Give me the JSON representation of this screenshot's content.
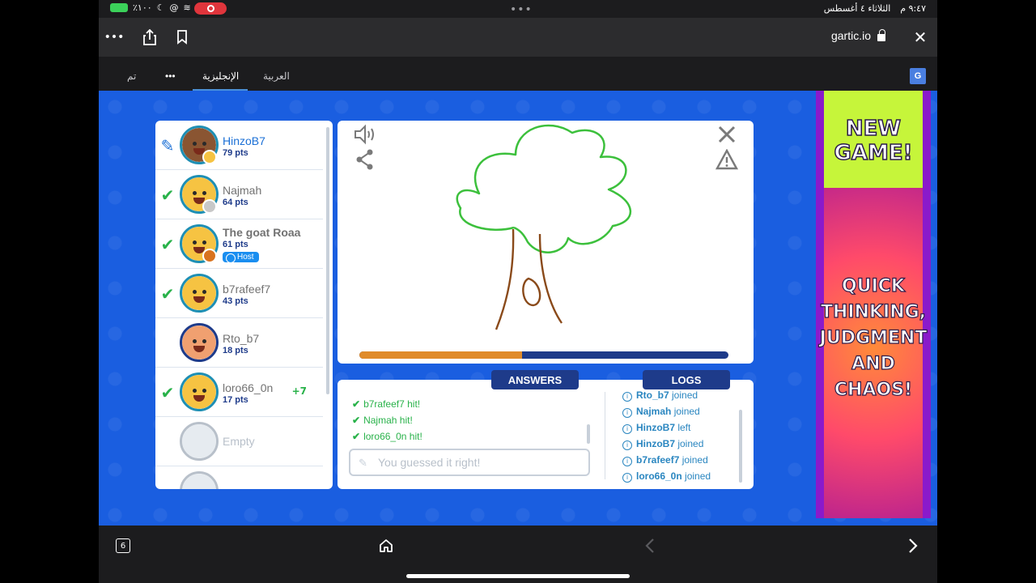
{
  "status": {
    "time": "٩:٤٧ م",
    "date": "الثلاثاء ٤ أغسطس",
    "battery": "٪١٠٠"
  },
  "browser": {
    "url": "gartic.io",
    "more_label": "•••",
    "close_label": "✕"
  },
  "translate": {
    "done_label": "تم",
    "more_label": "•••",
    "english_label": "الإنجليزية",
    "arabic_label": "العربية"
  },
  "players": [
    {
      "name": "HinzoB7",
      "pts": "79 pts",
      "status": "drawing",
      "gain": ""
    },
    {
      "name": "Najmah",
      "pts": "64 pts",
      "status": "guessed",
      "gain": ""
    },
    {
      "name": "The goat Roaa",
      "pts": "61 pts",
      "status": "guessed",
      "gain": "",
      "host_label": "Host"
    },
    {
      "name": "b7rafeef7",
      "pts": "43 pts",
      "status": "guessed",
      "gain": ""
    },
    {
      "name": "Rto_b7",
      "pts": "18 pts",
      "status": "none",
      "gain": ""
    },
    {
      "name": "loro66_0n",
      "pts": "17 pts",
      "status": "guessed",
      "gain": "+7"
    },
    {
      "name": "Empty",
      "pts": "",
      "status": "empty",
      "gain": ""
    }
  ],
  "round": {
    "progress_fraction": 0.44
  },
  "chat": {
    "answers_tab": "ANSWERS",
    "logs_tab": "LOGS",
    "answers": [
      {
        "name": "b7rafeef7",
        "text": "hit!"
      },
      {
        "name": "Najmah",
        "text": "hit!"
      },
      {
        "name": "loro66_0n",
        "text": "hit!"
      }
    ],
    "input_placeholder": "You guessed it right!",
    "logs": [
      {
        "name": "Rto_b7",
        "text": "joined"
      },
      {
        "name": "Najmah",
        "text": "joined"
      },
      {
        "name": "HinzoB7",
        "text": "left"
      },
      {
        "name": "HinzoB7",
        "text": "joined"
      },
      {
        "name": "b7rafeef7",
        "text": "joined"
      },
      {
        "name": "loro66_0n",
        "text": "joined"
      }
    ]
  },
  "ad": {
    "title_line1": "NEW",
    "title_line2": "GAME!",
    "body_line1": "QUICK",
    "body_line2": "THINKING,",
    "body_line3": "JUDGMENT",
    "body_line4": "AND",
    "body_line5": "CHAOS!"
  },
  "bottom": {
    "tab_count": "6"
  },
  "colors": {
    "game_bg": "#1a5ee0",
    "panel_navy": "#1e3b8a",
    "progress_orange": "#e08b2a",
    "guessed_green": "#29b24a",
    "tree_green": "#3cc03c",
    "tree_brown": "#8a4a1a"
  }
}
